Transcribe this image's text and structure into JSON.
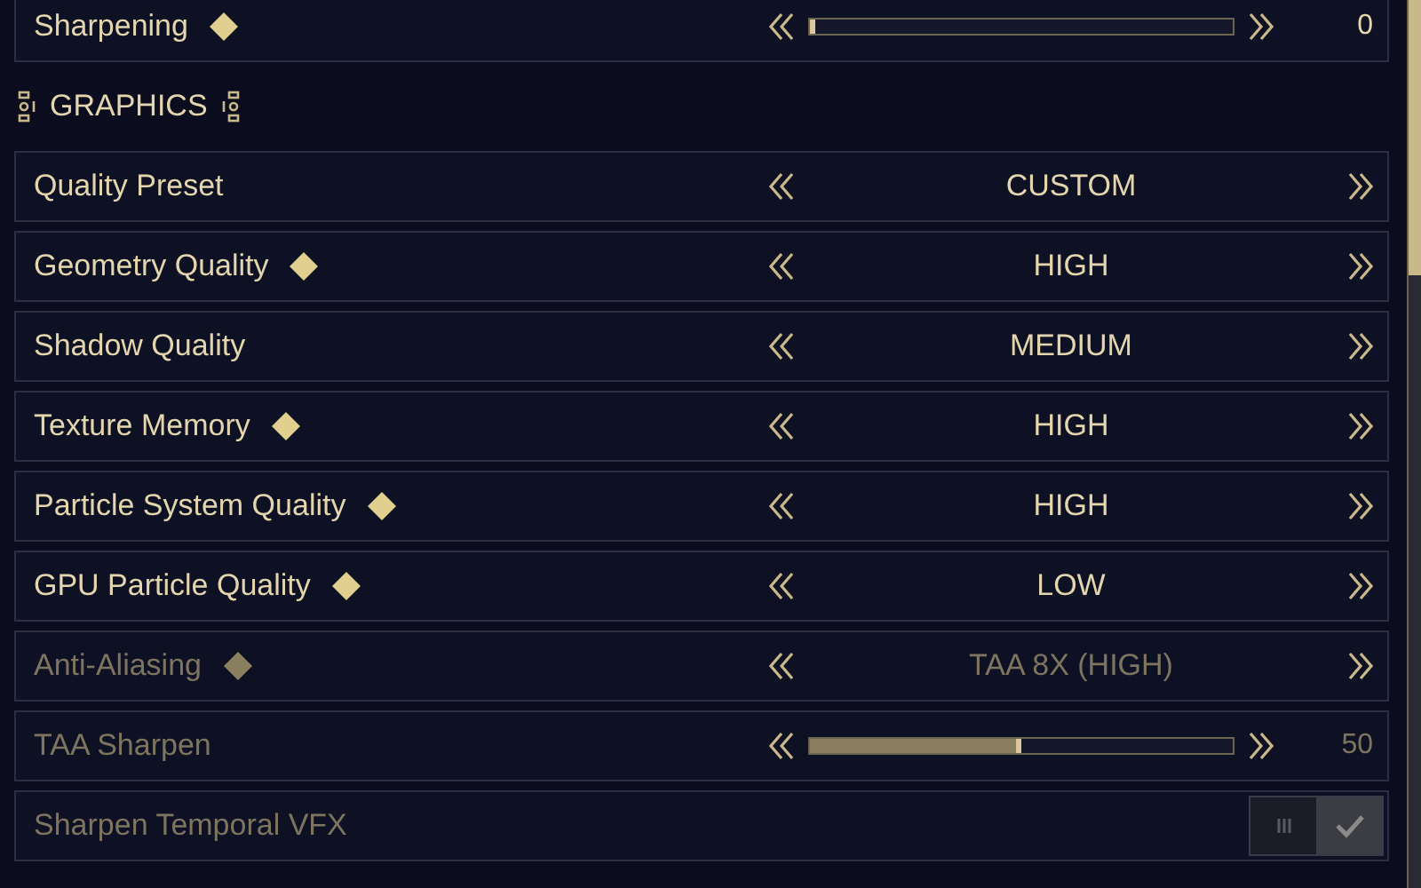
{
  "rows_top": [
    {
      "kind": "slider",
      "label": "Sharpening",
      "diamond": true,
      "disabled": false,
      "level": 0.0,
      "reading": "0"
    }
  ],
  "section": {
    "title": "GRAPHICS"
  },
  "rows": [
    {
      "kind": "selector",
      "label": "Quality Preset",
      "diamond": false,
      "disabled": false,
      "value": "CUSTOM"
    },
    {
      "kind": "selector",
      "label": "Geometry Quality",
      "diamond": true,
      "disabled": false,
      "value": "HIGH"
    },
    {
      "kind": "selector",
      "label": "Shadow Quality",
      "diamond": false,
      "disabled": false,
      "value": "MEDIUM"
    },
    {
      "kind": "selector",
      "label": "Texture Memory",
      "diamond": true,
      "disabled": false,
      "value": "HIGH"
    },
    {
      "kind": "selector",
      "label": "Particle System Quality",
      "diamond": true,
      "disabled": false,
      "value": "HIGH"
    },
    {
      "kind": "selector",
      "label": "GPU Particle Quality",
      "diamond": true,
      "disabled": false,
      "value": "LOW"
    },
    {
      "kind": "selector",
      "label": "Anti-Aliasing",
      "diamond": true,
      "disabled": true,
      "value": "TAA 8X (HIGH)"
    },
    {
      "kind": "slider",
      "label": "TAA Sharpen",
      "diamond": false,
      "disabled": true,
      "level": 0.5,
      "reading": "50"
    },
    {
      "kind": "toggle",
      "label": "Sharpen Temporal VFX",
      "diamond": false,
      "disabled": true,
      "checked": true
    }
  ]
}
